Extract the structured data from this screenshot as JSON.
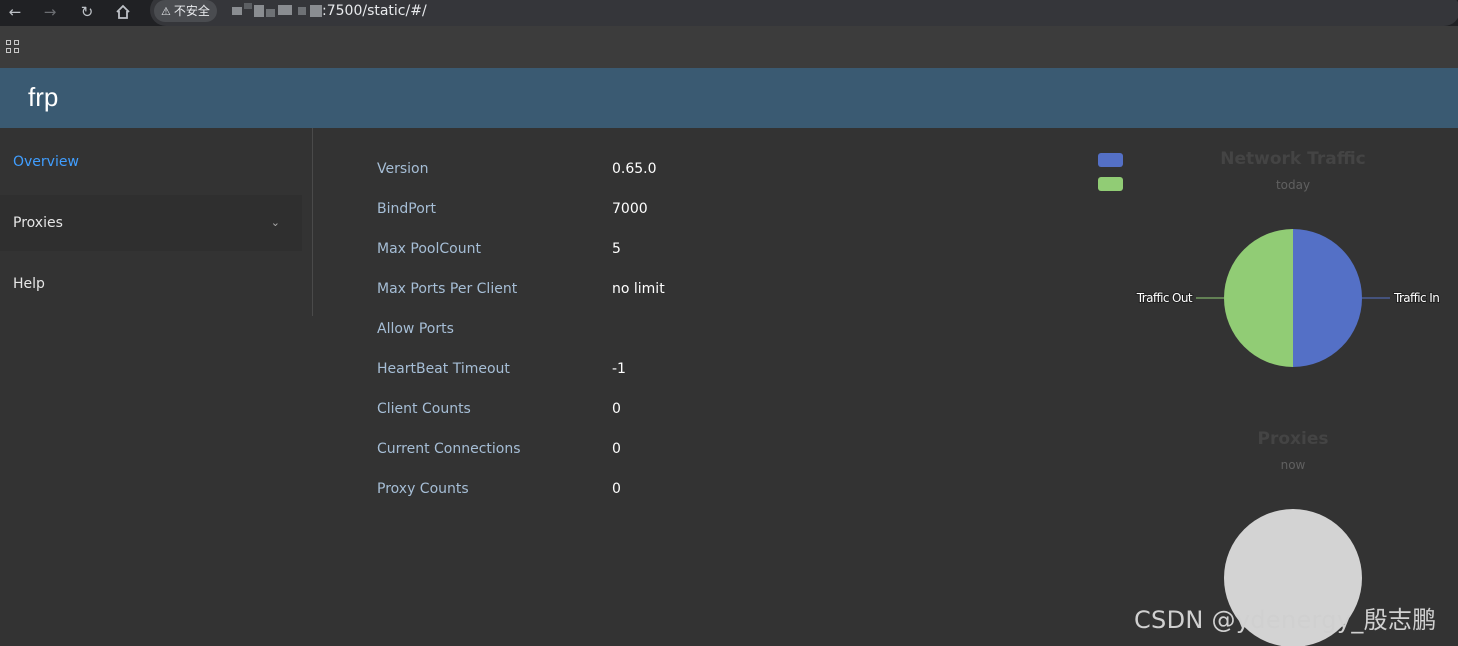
{
  "browser": {
    "security_label": "不安全",
    "url": ":7500/static/#/"
  },
  "app": {
    "title": "frp"
  },
  "sidebar": {
    "items": [
      {
        "label": "Overview"
      },
      {
        "label": "Proxies"
      },
      {
        "label": "Help"
      }
    ]
  },
  "overview": {
    "rows": [
      {
        "label": "Version",
        "value": "0.65.0"
      },
      {
        "label": "BindPort",
        "value": "7000"
      },
      {
        "label": "Max PoolCount",
        "value": "5"
      },
      {
        "label": "Max Ports Per Client",
        "value": "no limit"
      },
      {
        "label": "Allow Ports",
        "value": ""
      },
      {
        "label": "HeartBeat Timeout",
        "value": "-1"
      },
      {
        "label": "Client Counts",
        "value": "0"
      },
      {
        "label": "Current Connections",
        "value": "0"
      },
      {
        "label": "Proxy Counts",
        "value": "0"
      }
    ]
  },
  "charts": {
    "traffic": {
      "title": "Network Traffic",
      "subtitle": "today",
      "slices": [
        {
          "name": "Traffic In",
          "value": 50,
          "color": "#5470c6"
        },
        {
          "name": "Traffic Out",
          "value": 50,
          "color": "#91cc75"
        }
      ]
    },
    "proxies": {
      "title": "Proxies",
      "subtitle": "now",
      "empty_color": "#d3d3d3"
    }
  },
  "watermark": "CSDN @ydenergy_殷志鹏",
  "colors": {
    "header": "#3a5a72",
    "accent": "#409eff",
    "background": "#333333"
  }
}
